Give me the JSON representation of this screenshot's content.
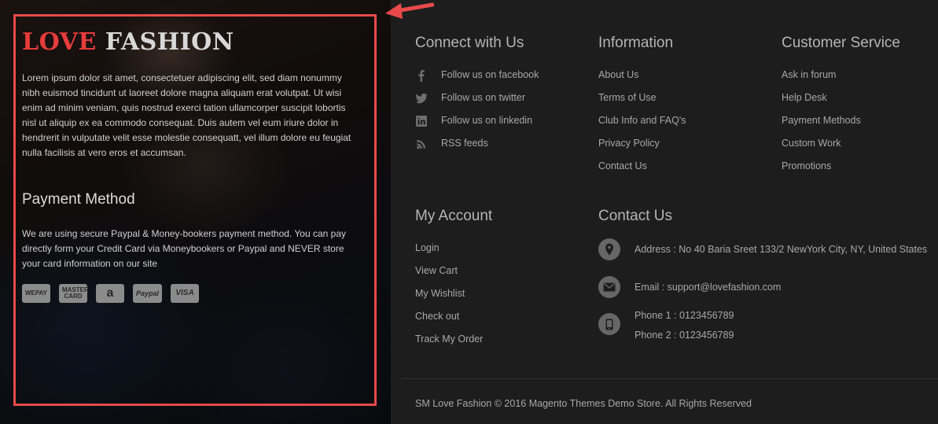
{
  "brand": {
    "word1": "LOVE",
    "word2": "FASHION"
  },
  "about": {
    "text": "Lorem ipsum dolor sit amet, consectetuer adipiscing elit, sed diam nonummy nibh euismod tincidunt ut laoreet dolore magna aliquam erat volutpat. Ut wisi enim ad minim veniam, quis nostrud exerci tation ullamcorper suscipit lobortis nisl ut aliquip ex ea commodo consequat. Duis autem vel eum iriure dolor in hendrerit in vulputate velit esse molestie consequatt, vel illum dolore eu feugiat nulla facilisis at vero eros et accumsan."
  },
  "payment": {
    "heading": "Payment Method",
    "text": "We are using secure Paypal & Money-bookers payment method. You can pay directly form your Credit Card via Moneybookers or Paypal and NEVER store your card information on our site",
    "icons": [
      {
        "name": "wepay-icon",
        "label": "WEPAY"
      },
      {
        "name": "mastercard-icon",
        "label": "MASTER CARD"
      },
      {
        "name": "amazon-icon",
        "label": "a"
      },
      {
        "name": "paypal-icon",
        "label": "Paypal"
      },
      {
        "name": "visa-icon",
        "label": "VISA"
      }
    ]
  },
  "connect": {
    "heading": "Connect with Us",
    "items": [
      {
        "icon": "facebook-icon",
        "label": "Follow us on facebook"
      },
      {
        "icon": "twitter-icon",
        "label": "Follow us on twitter"
      },
      {
        "icon": "linkedin-icon",
        "label": "Follow us on linkedin"
      },
      {
        "icon": "rss-icon",
        "label": "RSS feeds"
      }
    ]
  },
  "information": {
    "heading": "Information",
    "items": [
      "About Us",
      "Terms of Use",
      "Club Info and FAQ's",
      "Privacy Policy",
      "Contact Us"
    ]
  },
  "customer_service": {
    "heading": "Customer Service",
    "items": [
      "Ask in forum",
      "Help Desk",
      "Payment Methods",
      "Custom Work",
      "Promotions"
    ]
  },
  "account": {
    "heading": "My Account",
    "items": [
      "Login",
      "View Cart",
      "My Wishlist",
      "Check out",
      "Track My Order"
    ]
  },
  "contact": {
    "heading": "Contact Us",
    "address": "Address : No 40 Baria Sreet 133/2 NewYork City, NY, United States",
    "email": "Email : support@lovefashion.com",
    "phone1": "Phone 1 : 0123456789",
    "phone2": "Phone 2 : 0123456789"
  },
  "copyright": "SM Love Fashion © 2016 Magento Themes Demo Store. All Rights Reserved",
  "colors": {
    "brand_red": "#e63c3c",
    "highlight_border": "#e84a4a",
    "background": "#1d1d1d"
  }
}
